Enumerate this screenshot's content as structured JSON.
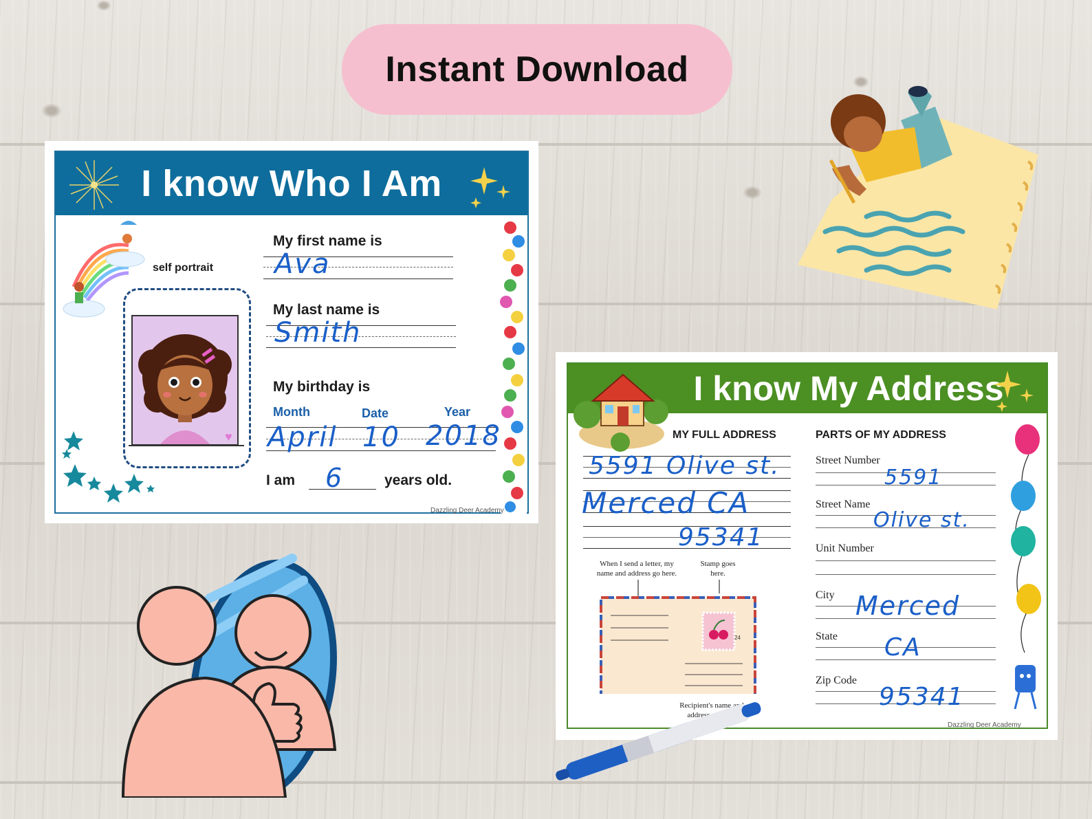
{
  "banner": {
    "text": "Instant Download"
  },
  "card_who": {
    "title": "I know Who I Am",
    "self_portrait": "self portrait",
    "first_name_label": "My first name is",
    "first_name_value": "Ava",
    "last_name_label": "My last name is",
    "last_name_value": "Smith",
    "birthday_label": "My birthday is",
    "month_label": "Month",
    "date_label": "Date",
    "year_label": "Year",
    "month_value": "April",
    "date_value": "10",
    "year_value": "2018",
    "age_prefix": "I am",
    "age_value": "6",
    "age_suffix": "years old.",
    "footer": "Dazzling Deer Academy"
  },
  "card_address": {
    "title": "I know My Address",
    "full_address_label": "MY FULL ADDRESS",
    "parts_label": "PARTS OF MY ADDRESS",
    "full_line_1": "5591 Olive st.",
    "full_line_2": "Merced CA",
    "full_line_3": "95341",
    "envelope_note_1": "When I send a letter, my name and address go here.",
    "envelope_note_2": "Stamp goes here.",
    "envelope_note_3": "Recipient's name and address go here.",
    "stamp_value": "24",
    "street_number_label": "Street Number",
    "street_number_value": "5591",
    "street_name_label": "Street Name",
    "street_name_value": "Olive st.",
    "unit_number_label": "Unit Number",
    "city_label": "City",
    "city_value": "Merced",
    "state_label": "State",
    "state_value": "CA",
    "zip_label": "Zip Code",
    "zip_value": "95341",
    "footer": "Dazzling Deer Academy"
  },
  "colors": {
    "banner": "#f6bfcf",
    "who_header": "#0e6d9c",
    "address_header": "#4c8f23",
    "handwriting": "#1a5fc8"
  }
}
